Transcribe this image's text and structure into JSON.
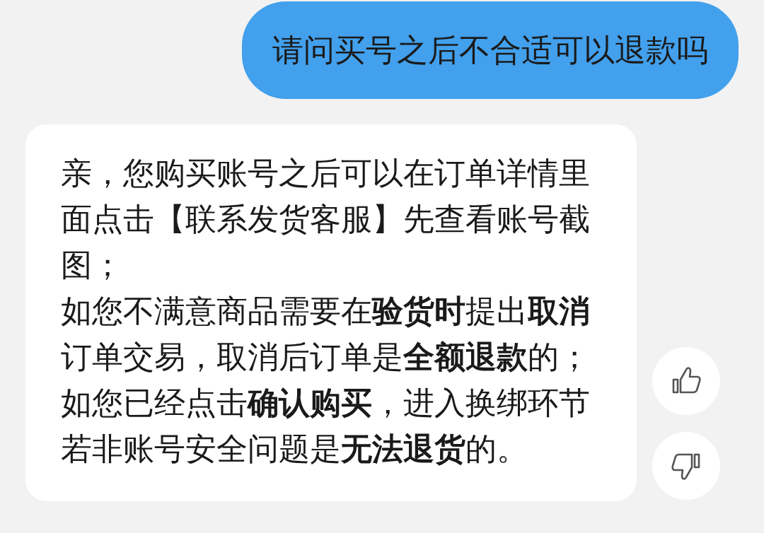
{
  "user_message": {
    "text": "请问买号之后不合适可以退款吗"
  },
  "reply": {
    "paragraphs": [
      "亲，您购买账号之后可以在订单详情里面点击【联系发货客服】先查看账号截图；",
      "如您不满意商品需要在**验货时**提出**取消**订单交易，取消后订单是**全额退款**的；",
      "如您已经点击**确认购买**，进入换绑环节若非账号安全问题是**无法退货**的。"
    ]
  },
  "feedback": [
    {
      "kind": "like"
    },
    {
      "kind": "dislike"
    }
  ]
}
